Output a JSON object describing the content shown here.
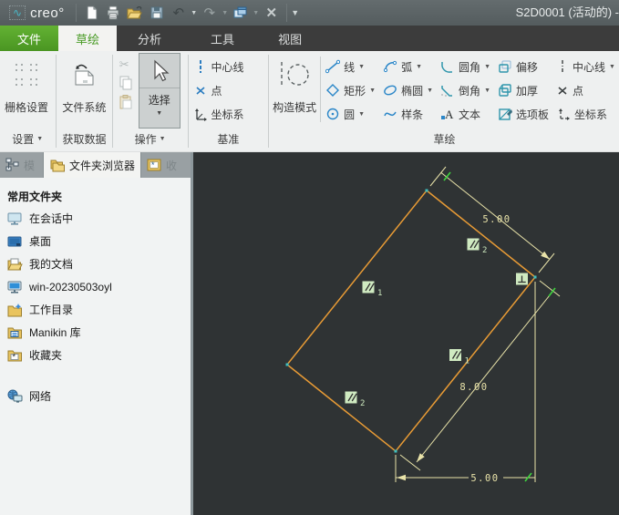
{
  "icons": {
    "dropdown": "▼",
    "logo_wave": "∿",
    "undo": "↶",
    "redo": "↷",
    "close_doc": "✕",
    "chevron": "▼",
    "scissors": "✂"
  },
  "titlebar": {
    "logo": "creo°",
    "title": "S2D0001 (活动的) -"
  },
  "tabbar": {
    "tabs": [
      {
        "label": "文件"
      },
      {
        "label": "草绘"
      },
      {
        "label": "分析"
      },
      {
        "label": "工具"
      },
      {
        "label": "视图"
      }
    ]
  },
  "ribbon": {
    "grid_settings": "栅格设置",
    "settings_label": "设置",
    "file_system": "文件系统",
    "get_data_label": "获取数据",
    "select": "选择",
    "operations_label": "操作",
    "datum": {
      "centerline": "中心线",
      "point": "点",
      "csys": "坐标系",
      "label": "基准"
    },
    "construction": "构造模式",
    "sketch": {
      "label": "草绘",
      "line": "线",
      "rect": "矩形",
      "circle": "圆",
      "arc": "弧",
      "ellipse": "椭圆",
      "spline": "样条",
      "fillet": "圆角",
      "chamfer": "倒角",
      "text": "文本",
      "offset": "偏移",
      "thicken": "加厚",
      "palette": "选项板",
      "centerline2": "中心线",
      "point2": "点",
      "csys2": "坐标系"
    }
  },
  "sidebar": {
    "tabs": [
      {
        "label": "模"
      },
      {
        "label": "文件夹浏览器"
      },
      {
        "label": "收"
      }
    ],
    "header": "常用文件夹",
    "items": [
      {
        "label": "在会话中"
      },
      {
        "label": "桌面"
      },
      {
        "label": "我的文档"
      },
      {
        "label": "win-20230503oyl"
      },
      {
        "label": "工作目录"
      },
      {
        "label": "Manikin 库"
      },
      {
        "label": "收藏夹"
      }
    ],
    "network": "网络"
  },
  "canvas": {
    "dim_top": "5.00",
    "dim_right": "8.00",
    "dim_bottom": "5.00",
    "sub_a1": "1",
    "sub_a2": "2",
    "sub_b1": "1",
    "sub_b2": "2"
  }
}
